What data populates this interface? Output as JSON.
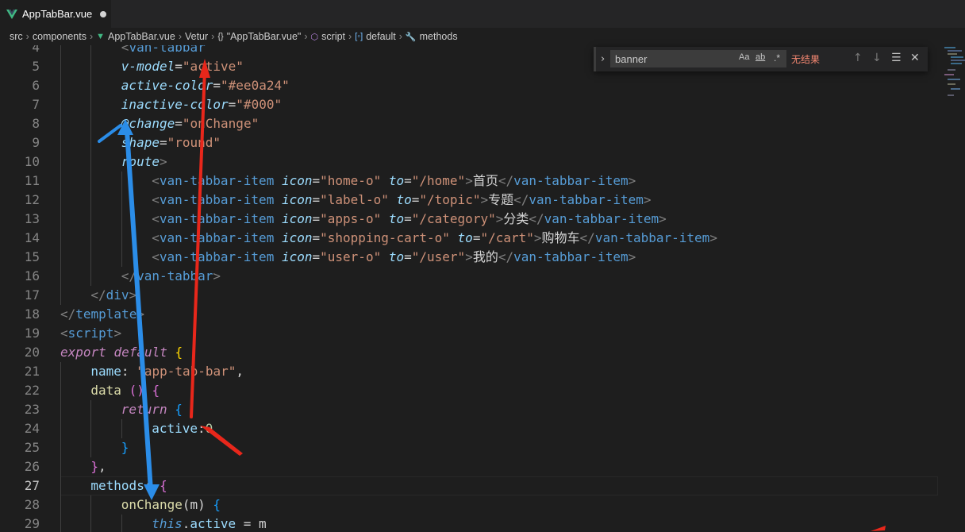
{
  "tab": {
    "filename": "AppTabBar.vue",
    "icon": "vue-icon",
    "dirty": true
  },
  "breadcrumb": {
    "items": [
      "src",
      "components",
      "AppTabBar.vue",
      "Vetur",
      "\"AppTabBar.vue\"",
      "script",
      "default",
      "methods"
    ],
    "icons": [
      "",
      "",
      "vue-icon",
      "",
      "braces-icon",
      "cube-icon",
      "object-icon",
      "wrench-icon"
    ]
  },
  "find_widget": {
    "query": "banner",
    "match_case": "Aa",
    "whole_word": "ab",
    "regex": ".*",
    "result": "无结果"
  },
  "editor": {
    "current_line": 27,
    "lines": [
      {
        "n": "4",
        "tokens": [
          [
            "tag",
            "<"
          ],
          [
            "name",
            "van-tabbar"
          ]
        ]
      },
      {
        "n": "5",
        "tokens": [
          [
            "attr",
            "v-model"
          ],
          [
            "txt",
            "="
          ],
          [
            "str",
            "\"active\""
          ]
        ]
      },
      {
        "n": "6",
        "tokens": [
          [
            "attr",
            "active-color"
          ],
          [
            "txt",
            "="
          ],
          [
            "str",
            "\"#ee0a24\""
          ]
        ]
      },
      {
        "n": "7",
        "tokens": [
          [
            "attr",
            "inactive-color"
          ],
          [
            "txt",
            "="
          ],
          [
            "str",
            "\"#000\""
          ]
        ]
      },
      {
        "n": "8",
        "tokens": [
          [
            "attr",
            "@change"
          ],
          [
            "txt",
            "="
          ],
          [
            "str",
            "\"onChange\""
          ]
        ]
      },
      {
        "n": "9",
        "tokens": [
          [
            "attr",
            "shape"
          ],
          [
            "txt",
            "="
          ],
          [
            "str",
            "\"round\""
          ]
        ]
      },
      {
        "n": "10",
        "tokens": [
          [
            "attr",
            "route"
          ],
          [
            "tag",
            ">"
          ]
        ]
      },
      {
        "n": "11",
        "tokens": [
          [
            "tag",
            "<"
          ],
          [
            "name",
            "van-tabbar-item"
          ],
          [
            "txt",
            " "
          ],
          [
            "attr",
            "icon"
          ],
          [
            "txt",
            "="
          ],
          [
            "str",
            "\"home-o\""
          ],
          [
            "txt",
            " "
          ],
          [
            "attr",
            "to"
          ],
          [
            "txt",
            "="
          ],
          [
            "str",
            "\"/home\""
          ],
          [
            "tag",
            ">"
          ],
          [
            "cjk",
            "首页"
          ],
          [
            "tag",
            "</"
          ],
          [
            "name",
            "van-tabbar-item"
          ],
          [
            "tag",
            ">"
          ]
        ]
      },
      {
        "n": "12",
        "tokens": [
          [
            "tag",
            "<"
          ],
          [
            "name",
            "van-tabbar-item"
          ],
          [
            "txt",
            " "
          ],
          [
            "attr",
            "icon"
          ],
          [
            "txt",
            "="
          ],
          [
            "str",
            "\"label-o\""
          ],
          [
            "txt",
            " "
          ],
          [
            "attr",
            "to"
          ],
          [
            "txt",
            "="
          ],
          [
            "str",
            "\"/topic\""
          ],
          [
            "tag",
            ">"
          ],
          [
            "cjk",
            "专题"
          ],
          [
            "tag",
            "</"
          ],
          [
            "name",
            "van-tabbar-item"
          ],
          [
            "tag",
            ">"
          ]
        ]
      },
      {
        "n": "13",
        "tokens": [
          [
            "tag",
            "<"
          ],
          [
            "name",
            "van-tabbar-item"
          ],
          [
            "txt",
            " "
          ],
          [
            "attr",
            "icon"
          ],
          [
            "txt",
            "="
          ],
          [
            "str",
            "\"apps-o\""
          ],
          [
            "txt",
            " "
          ],
          [
            "attr",
            "to"
          ],
          [
            "txt",
            "="
          ],
          [
            "str",
            "\"/category\""
          ],
          [
            "tag",
            ">"
          ],
          [
            "cjk",
            "分类"
          ],
          [
            "tag",
            "</"
          ],
          [
            "name",
            "van-tabbar-item"
          ],
          [
            "tag",
            ">"
          ]
        ]
      },
      {
        "n": "14",
        "tokens": [
          [
            "tag",
            "<"
          ],
          [
            "name",
            "van-tabbar-item"
          ],
          [
            "txt",
            " "
          ],
          [
            "attr",
            "icon"
          ],
          [
            "txt",
            "="
          ],
          [
            "str",
            "\"shopping-cart-o\""
          ],
          [
            "txt",
            " "
          ],
          [
            "attr",
            "to"
          ],
          [
            "txt",
            "="
          ],
          [
            "str",
            "\"/cart\""
          ],
          [
            "tag",
            ">"
          ],
          [
            "cjk",
            "购物车"
          ],
          [
            "tag",
            "</"
          ],
          [
            "name",
            "van-tabbar-item"
          ],
          [
            "tag",
            ">"
          ]
        ]
      },
      {
        "n": "15",
        "tokens": [
          [
            "tag",
            "<"
          ],
          [
            "name",
            "van-tabbar-item"
          ],
          [
            "txt",
            " "
          ],
          [
            "attr",
            "icon"
          ],
          [
            "txt",
            "="
          ],
          [
            "str",
            "\"user-o\""
          ],
          [
            "txt",
            " "
          ],
          [
            "attr",
            "to"
          ],
          [
            "txt",
            "="
          ],
          [
            "str",
            "\"/user\""
          ],
          [
            "tag",
            ">"
          ],
          [
            "cjk",
            "我的"
          ],
          [
            "tag",
            "</"
          ],
          [
            "name",
            "van-tabbar-item"
          ],
          [
            "tag",
            ">"
          ]
        ]
      },
      {
        "n": "16",
        "tokens": [
          [
            "tag",
            "</"
          ],
          [
            "name",
            "van-tabbar"
          ],
          [
            "tag",
            ">"
          ]
        ]
      },
      {
        "n": "17",
        "tokens": [
          [
            "tag",
            "</"
          ],
          [
            "name",
            "div"
          ],
          [
            "tag",
            ">"
          ]
        ]
      },
      {
        "n": "18",
        "tokens": [
          [
            "tag",
            "</"
          ],
          [
            "name",
            "template"
          ],
          [
            "tag",
            ">"
          ]
        ]
      },
      {
        "n": "19",
        "tokens": [
          [
            "tag",
            "<"
          ],
          [
            "name",
            "script"
          ],
          [
            "tag",
            ">"
          ]
        ]
      },
      {
        "n": "20",
        "tokens": [
          [
            "kw",
            "export"
          ],
          [
            "txt",
            " "
          ],
          [
            "kw",
            "default"
          ],
          [
            "txt",
            " "
          ],
          [
            "br1",
            "{"
          ]
        ]
      },
      {
        "n": "21",
        "tokens": [
          [
            "prop",
            "name"
          ],
          [
            "txt",
            ": "
          ],
          [
            "str",
            "\"app-tab-bar\""
          ],
          [
            "txt",
            ","
          ]
        ]
      },
      {
        "n": "22",
        "tokens": [
          [
            "fn",
            "data"
          ],
          [
            "txt",
            " "
          ],
          [
            "br2",
            "()"
          ],
          [
            "txt",
            " "
          ],
          [
            "br2",
            "{"
          ]
        ]
      },
      {
        "n": "23",
        "tokens": [
          [
            "kw",
            "return"
          ],
          [
            "txt",
            " "
          ],
          [
            "br3",
            "{"
          ]
        ]
      },
      {
        "n": "24",
        "tokens": [
          [
            "prop",
            "active"
          ],
          [
            "txt",
            ":"
          ],
          [
            "num",
            "0"
          ]
        ]
      },
      {
        "n": "25",
        "tokens": [
          [
            "br3",
            "}"
          ]
        ]
      },
      {
        "n": "26",
        "tokens": [
          [
            "br2",
            "}"
          ],
          [
            "txt",
            ","
          ]
        ]
      },
      {
        "n": "27",
        "tokens": [
          [
            "prop",
            "methods"
          ],
          [
            "txt",
            ": "
          ],
          [
            "br2",
            "{"
          ]
        ]
      },
      {
        "n": "28",
        "tokens": [
          [
            "fn",
            "onChange"
          ],
          [
            "txt",
            "(m) "
          ],
          [
            "br3",
            "{"
          ]
        ]
      },
      {
        "n": "29",
        "tokens": [
          [
            "this",
            "this"
          ],
          [
            "txt",
            "."
          ],
          [
            "prop",
            "active"
          ],
          [
            "txt",
            " = m"
          ]
        ]
      }
    ]
  }
}
